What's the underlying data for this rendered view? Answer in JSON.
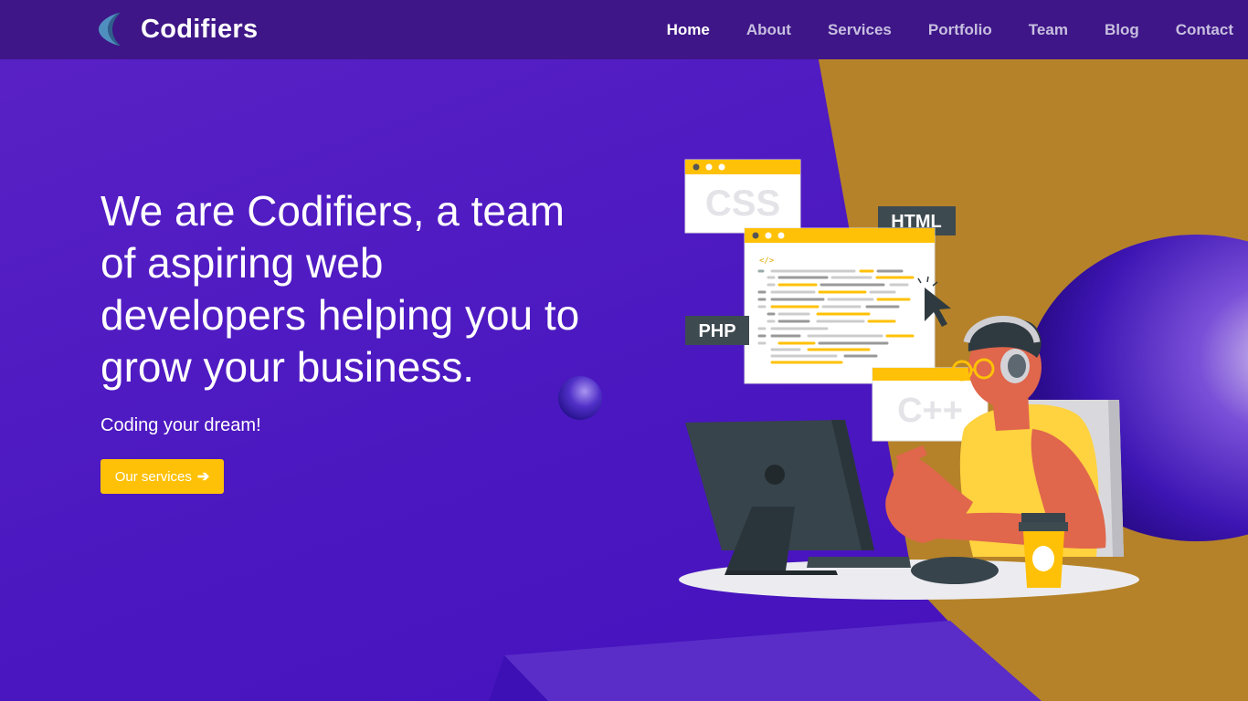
{
  "brand": {
    "name": "Codifiers",
    "logo_icon": "crescent-logo-icon"
  },
  "nav": {
    "items": [
      {
        "label": "Home",
        "active": true
      },
      {
        "label": "About",
        "active": false
      },
      {
        "label": "Services",
        "active": false
      },
      {
        "label": "Portfolio",
        "active": false
      },
      {
        "label": "Team",
        "active": false
      },
      {
        "label": "Blog",
        "active": false
      },
      {
        "label": "Contact",
        "active": false
      }
    ]
  },
  "hero": {
    "title": "We are Codifiers, a team of aspiring web developers helping you to grow your business.",
    "subtitle": "Coding your dream!",
    "cta_label": "Our services",
    "cta_icon": "arrow-right-icon"
  },
  "illustration": {
    "labels": {
      "css": "CSS",
      "html": "HTML",
      "php": "PHP",
      "cpp": "C++"
    }
  },
  "colors": {
    "nav_bg": "#3e1687",
    "hero_bg": "#4f1bc4",
    "accent_gold": "#b58229",
    "button": "#ffc107"
  }
}
